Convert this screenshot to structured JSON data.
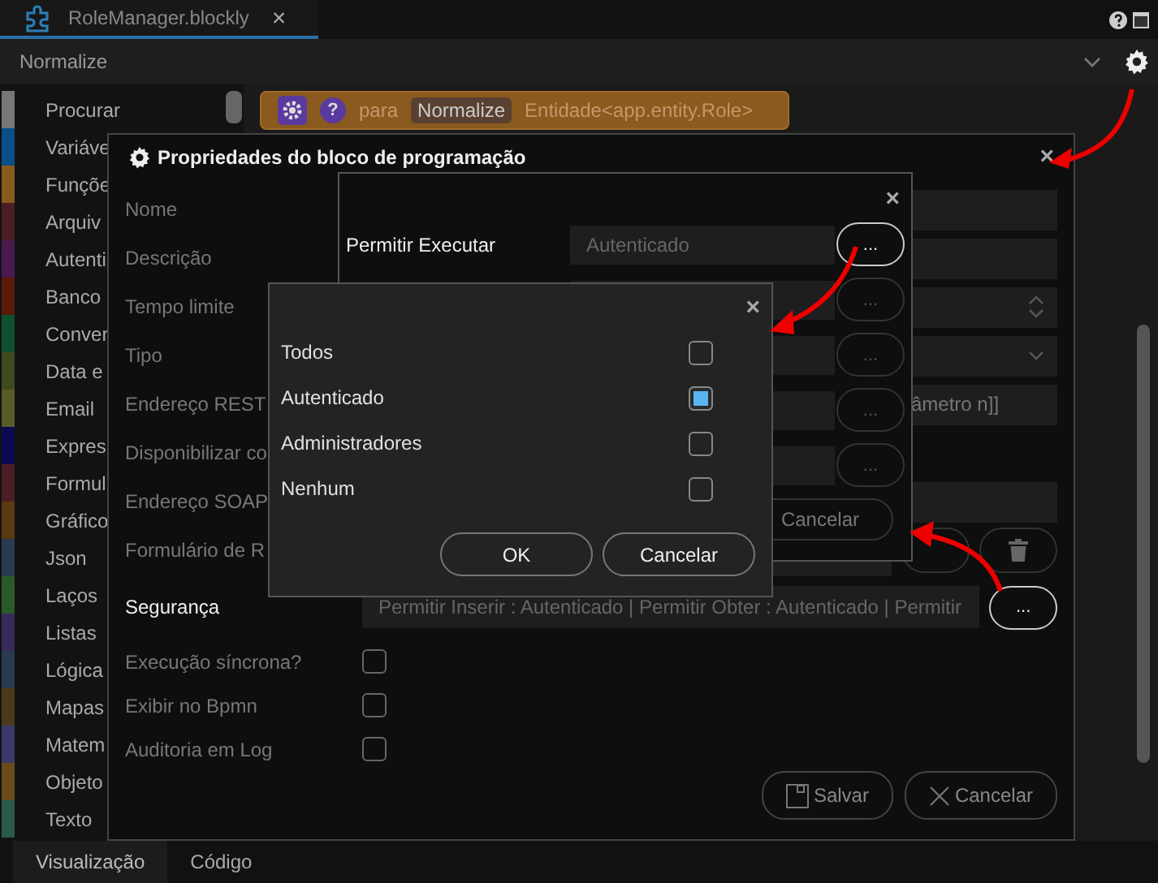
{
  "tab": {
    "title": "RoleManager.blockly",
    "close": "×"
  },
  "toolbar": {
    "title": "Normalize"
  },
  "sidebar": {
    "items": [
      {
        "label": "Procurar",
        "color": "#777777"
      },
      {
        "label": "Variáve",
        "color": "#0b4f8a"
      },
      {
        "label": "Funçõe",
        "color": "#8a5a1e"
      },
      {
        "label": "Arquiv",
        "color": "#4a1e24"
      },
      {
        "label": "Autenti",
        "color": "#4a1a4f"
      },
      {
        "label": "Banco",
        "color": "#5a1a0a"
      },
      {
        "label": "Conver",
        "color": "#0f5030"
      },
      {
        "label": "Data e",
        "color": "#3f4a1e"
      },
      {
        "label": "Email",
        "color": "#5a5a2a"
      },
      {
        "label": "Expres",
        "color": "#0a0a50"
      },
      {
        "label": "Formul",
        "color": "#4a1e24"
      },
      {
        "label": "Gráfico",
        "color": "#5a3a10"
      },
      {
        "label": "Json",
        "color": "#2a3a50"
      },
      {
        "label": "Laços",
        "color": "#2a5a2a"
      },
      {
        "label": "Listas",
        "color": "#3a2a5a"
      },
      {
        "label": "Lógica",
        "color": "#2a3a50"
      },
      {
        "label": "Mapas",
        "color": "#4a3a1a"
      },
      {
        "label": "Matem",
        "color": "#3a3a6a"
      },
      {
        "label": "Objeto",
        "color": "#6a4a1a"
      },
      {
        "label": "Texto",
        "color": "#2a5a4a"
      }
    ]
  },
  "block": {
    "help": "?",
    "keyword": "para",
    "name": "Normalize",
    "entity": "Entidade<app.entity.Role>"
  },
  "bottom_tabs": [
    {
      "label": "Visualização",
      "selected": true
    },
    {
      "label": "Código",
      "selected": false
    }
  ],
  "properties_dialog": {
    "title": "Propriedades do bloco de programação",
    "close": "×",
    "rows": [
      {
        "label": "Nome",
        "kind": "text"
      },
      {
        "label": "Descrição",
        "kind": "text"
      },
      {
        "label": "Tempo limite",
        "kind": "number"
      },
      {
        "label": "Tipo",
        "kind": "select"
      },
      {
        "label": "Endereço REST",
        "kind": "text",
        "value": "âmetro n]]"
      },
      {
        "label": "Disponibilizar co",
        "kind": "none"
      },
      {
        "label": "Endereço SOAP",
        "kind": "text"
      },
      {
        "label": "Formulário de R",
        "kind": "actions"
      },
      {
        "label": "Segurança",
        "kind": "security",
        "value": "Permitir Inserir : Autenticado | Permitir Obter : Autenticado | Permitir",
        "button": "..."
      },
      {
        "label": "Execução síncrona?",
        "kind": "checkbox",
        "checked": false
      },
      {
        "label": "Exibir no Bpmn",
        "kind": "checkbox",
        "checked": false
      },
      {
        "label": "Auditoria em Log",
        "kind": "checkbox",
        "checked": false
      }
    ],
    "buttons": [
      {
        "label": "Salvar",
        "kind": "save"
      },
      {
        "label": "Cancelar",
        "kind": "cancel"
      }
    ]
  },
  "permission_dialog": {
    "close": "×",
    "label": "Permitir Executar",
    "value": "Autenticado",
    "button": "...",
    "other_buttons": [
      "...",
      "...",
      "...",
      "..."
    ],
    "cancel": "Cancelar"
  },
  "choice_dialog": {
    "close": "×",
    "options": [
      {
        "label": "Todos",
        "checked": false
      },
      {
        "label": "Autenticado",
        "checked": true
      },
      {
        "label": "Administradores",
        "checked": false
      },
      {
        "label": "Nenhum",
        "checked": false
      }
    ],
    "ok": "OK",
    "cancel": "Cancelar"
  }
}
